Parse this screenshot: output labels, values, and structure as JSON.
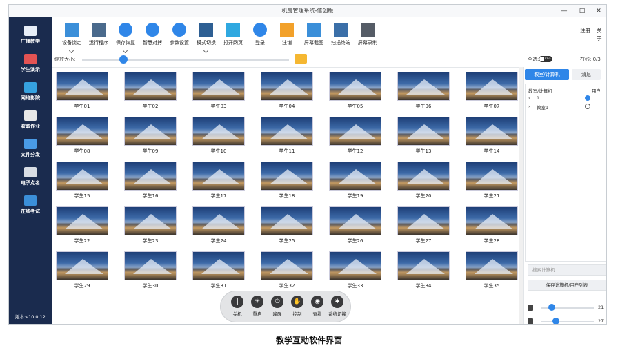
{
  "window": {
    "title": "机房管理系统-信创版",
    "minimize": "—",
    "maximize": "□",
    "close": "✕"
  },
  "sidebar": {
    "items": [
      {
        "label": "广播教学",
        "icon": "monitor-icon",
        "color": "#e7eef8"
      },
      {
        "label": "学生演示",
        "icon": "presenter-icon",
        "color": "#e35353"
      },
      {
        "label": "网络影院",
        "icon": "film-icon",
        "color": "#36a2e0"
      },
      {
        "label": "收取作业",
        "icon": "document-icon",
        "color": "#e8e8e8"
      },
      {
        "label": "文件分发",
        "icon": "folder-icon",
        "color": "#4a9be6"
      },
      {
        "label": "电子点名",
        "icon": "camera-icon",
        "color": "#d8dde4"
      },
      {
        "label": "在线考试",
        "icon": "laptop-icon",
        "color": "#3b8fd9"
      }
    ],
    "version": "版本:v10.0.12"
  },
  "toolbar": {
    "items": [
      {
        "label": "设备锁定",
        "icon": "device-lock-icon",
        "color": "#3b8fd9",
        "round": false,
        "caret": true
      },
      {
        "label": "运行程序",
        "icon": "program-icon",
        "color": "#4a6a8c",
        "round": false,
        "caret": false
      },
      {
        "label": "保存恢复",
        "icon": "download-icon",
        "color": "#2f86e8",
        "round": true,
        "caret": true
      },
      {
        "label": "智慧对拷",
        "icon": "send-icon",
        "color": "#2f86e8",
        "round": true,
        "caret": false
      },
      {
        "label": "参数设置",
        "icon": "gear-icon",
        "color": "#2f86e8",
        "round": true,
        "caret": false
      },
      {
        "label": "模式切换",
        "icon": "mode-switch-icon",
        "color": "#2e5f93",
        "round": false,
        "caret": true
      },
      {
        "label": "打开网页",
        "icon": "wifi-icon",
        "color": "#2fa8e0",
        "round": false,
        "caret": false
      },
      {
        "label": "登录",
        "icon": "login-icon",
        "color": "#2f86e8",
        "round": true,
        "caret": false
      },
      {
        "label": "注销",
        "icon": "logout-icon",
        "color": "#f2a12a",
        "round": false,
        "caret": false
      },
      {
        "label": "屏幕截图",
        "icon": "screenshot-icon",
        "color": "#3b8fd9",
        "round": false,
        "caret": false
      },
      {
        "label": "扫描终端",
        "icon": "scan-icon",
        "color": "#3b6fa8",
        "round": false,
        "caret": false
      },
      {
        "label": "屏幕录制",
        "icon": "video-camera-icon",
        "color": "#555c66",
        "round": false,
        "caret": false
      }
    ],
    "register": "注册",
    "about": "关于"
  },
  "zoom": {
    "label": "缩放大小:",
    "level": 0.2
  },
  "selection": {
    "select_all": "全选:",
    "toggle": "OFF",
    "online": "在线: 0/3"
  },
  "students": [
    "学生01",
    "学生02",
    "学生03",
    "学生04",
    "学生05",
    "学生06",
    "学生07",
    "学生08",
    "学生09",
    "学生10",
    "学生11",
    "学生12",
    "学生13",
    "学生14",
    "学生15",
    "学生16",
    "学生17",
    "学生18",
    "学生19",
    "学生20",
    "学生21",
    "学生22",
    "学生23",
    "学生24",
    "学生25",
    "学生26",
    "学生27",
    "学生28",
    "学生29",
    "学生30",
    "学生31",
    "学生32",
    "学生33",
    "学生34",
    "学生35"
  ],
  "dock": {
    "items": [
      {
        "label": "关机",
        "icon": "power-off-icon",
        "glyph": "❙"
      },
      {
        "label": "重启",
        "icon": "restart-icon",
        "glyph": "✳"
      },
      {
        "label": "唤醒",
        "icon": "wake-icon",
        "glyph": "⏻"
      },
      {
        "label": "控制",
        "icon": "hand-control-icon",
        "glyph": "✋"
      },
      {
        "label": "查看",
        "icon": "eye-icon",
        "glyph": "◉"
      },
      {
        "label": "系统切换",
        "icon": "system-switch-icon",
        "glyph": "✱"
      }
    ]
  },
  "rightpanel": {
    "tab_computers": "教室/计算机",
    "tab_messages": "消息",
    "header_name": "教室/计算机",
    "header_user": "用户",
    "tree": [
      {
        "chevron": "›",
        "name": "1",
        "checked": true
      },
      {
        "chevron": "›",
        "name": "教室1",
        "checked": false
      }
    ],
    "search_placeholder": "搜索计算机",
    "save_button": "保存计算机/用户列表",
    "speaker_volume": "21",
    "mic_volume": "27"
  },
  "caption": "教学互动软件界面"
}
